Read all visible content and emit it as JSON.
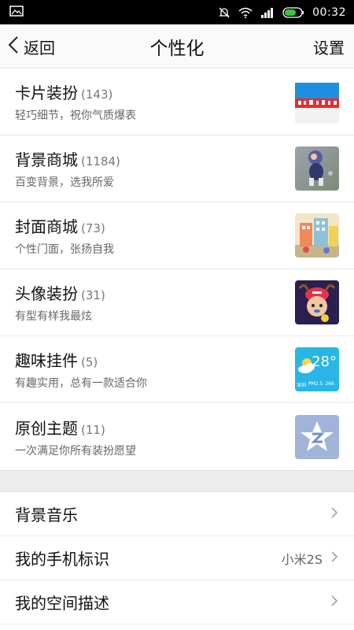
{
  "status_bar": {
    "time": "00:32",
    "icons": [
      "image-icon",
      "mute-icon",
      "wifi-icon",
      "signal-icon",
      "battery-charging-icon"
    ]
  },
  "header": {
    "back_label": "返回",
    "title": "个性化",
    "settings_label": "设置"
  },
  "cards": [
    {
      "title": "卡片装扮",
      "count": "(143)",
      "subtitle": "轻巧细节，祝你气质爆表",
      "thumb": "card-thumbnail"
    },
    {
      "title": "背景商城",
      "count": "(1184)",
      "subtitle": "百变背景，选我所爱",
      "thumb": "background-thumbnail"
    },
    {
      "title": "封面商城",
      "count": "(73)",
      "subtitle": "个性门面，张扬自我",
      "thumb": "cover-thumbnail"
    },
    {
      "title": "头像装扮",
      "count": "(31)",
      "subtitle": "有型有样我最炫",
      "thumb": "avatar-thumbnail"
    },
    {
      "title": "趣味挂件",
      "count": "(5)",
      "subtitle": "有趣实用，总有一款适合你",
      "thumb": "widget-thumbnail"
    },
    {
      "title": "原创主题",
      "count": "(11)",
      "subtitle": "一次满足你所有装扮愿望",
      "thumb": "theme-thumbnail"
    }
  ],
  "widget_thumb": {
    "temp": "28°",
    "city": "深圳",
    "pm": "PM2.5",
    "pm_value": "266"
  },
  "settings": [
    {
      "label": "背景音乐",
      "value": ""
    },
    {
      "label": "我的手机标识",
      "value": "小米2S"
    },
    {
      "label": "我的空间描述",
      "value": ""
    }
  ],
  "colors": {
    "status_bar": "#000000",
    "header_bg": "#fafafa",
    "divider": "#e8e8e8",
    "gap_bg": "#ececec",
    "widget_blue": "#29b6e6"
  }
}
